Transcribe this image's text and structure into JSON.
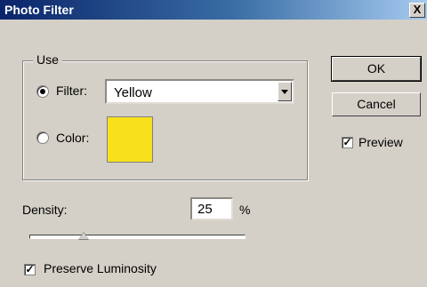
{
  "window": {
    "title": "Photo Filter",
    "close_glyph": "X"
  },
  "use_group": {
    "label": "Use",
    "filter": {
      "label": "Filter:",
      "selected": true,
      "value": "Yellow"
    },
    "color": {
      "label": "Color:",
      "selected": false,
      "swatch": "#f8e01c"
    }
  },
  "buttons": {
    "ok": "OK",
    "cancel": "Cancel"
  },
  "preview": {
    "label": "Preview",
    "checked": true,
    "mark": "✓"
  },
  "density": {
    "label": "Density:",
    "value": "25",
    "unit": "%",
    "level": 0.25
  },
  "preserve": {
    "label": "Preserve Luminosity",
    "checked": true,
    "mark": "✓"
  }
}
